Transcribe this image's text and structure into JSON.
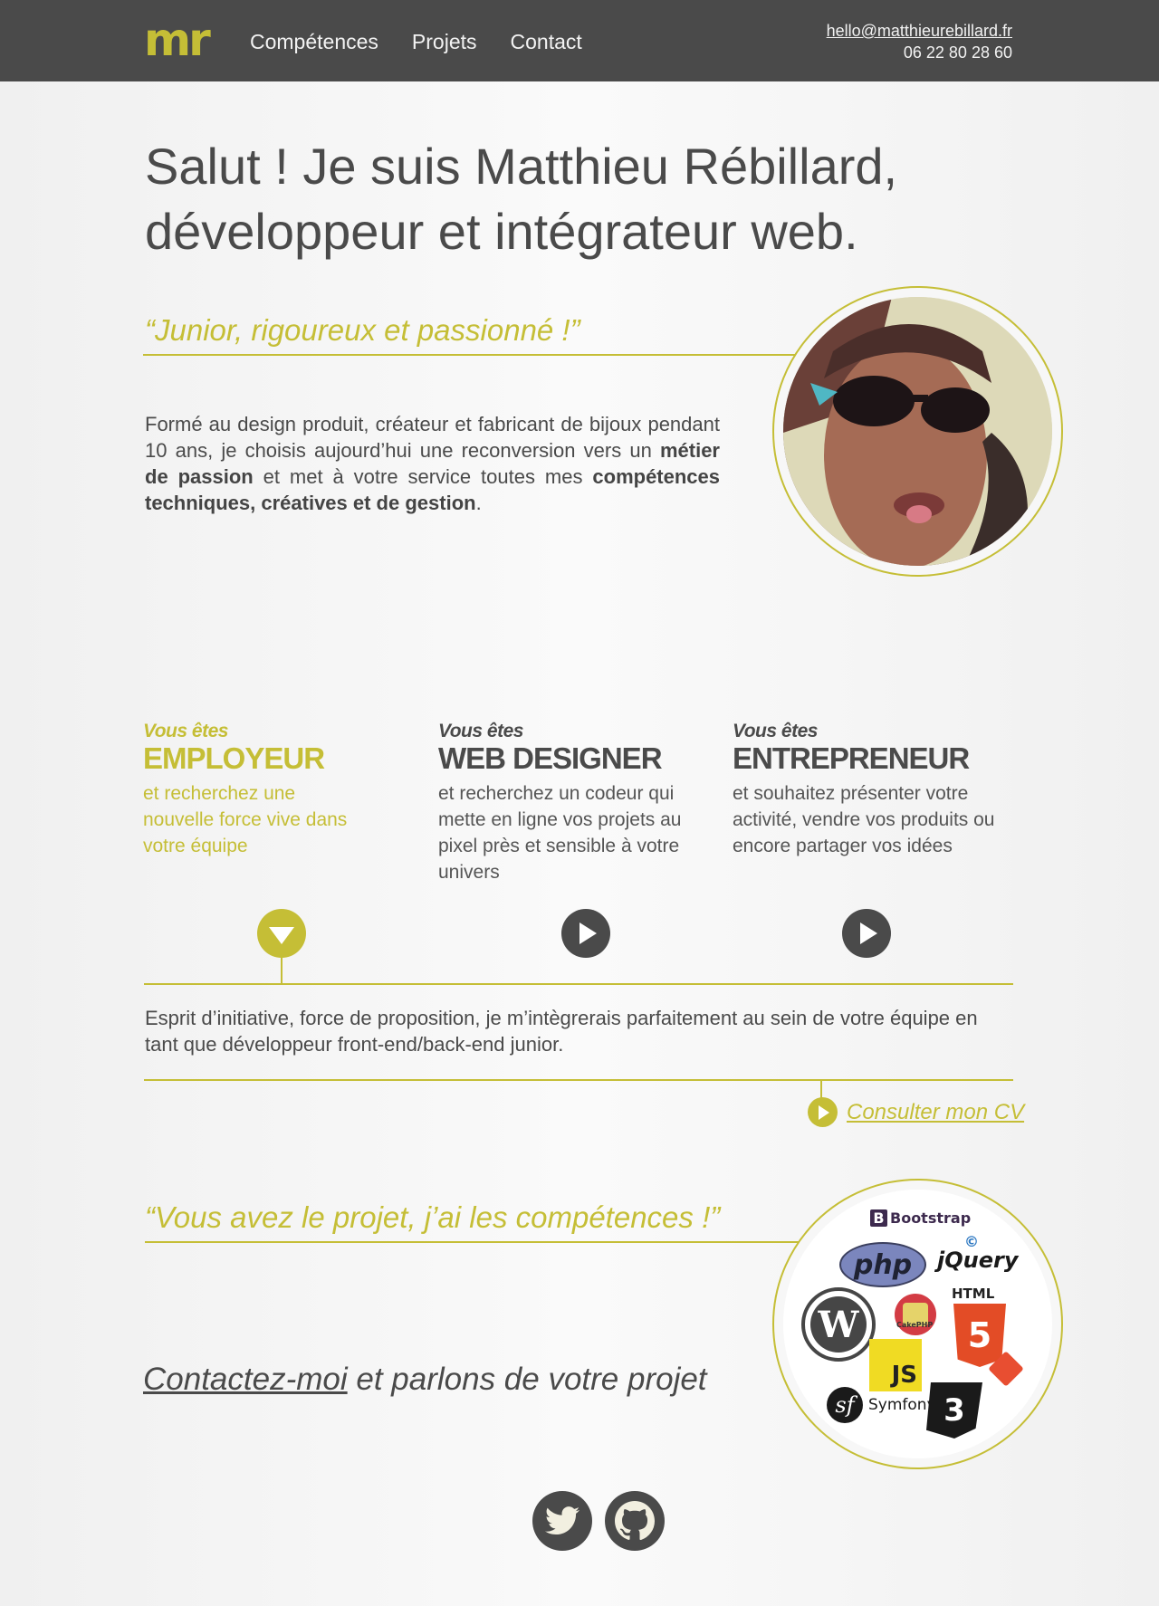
{
  "header": {
    "logo": "mr",
    "nav": [
      "Compétences",
      "Projets",
      "Contact"
    ],
    "email": "hello@matthieurebillard.fr",
    "phone": "06 22 80 28 60"
  },
  "intro": {
    "headline_line1": "Salut ! Je suis Matthieu Rébillard,",
    "headline_line2": "développeur et intégrateur web.",
    "quote": "“Junior, rigoureux et passionné !”",
    "text_part1": "Formé au design produit, créateur et fabricant de bijoux pendant 10 ans, je choisis aujourd’hui une reconversion vers un ",
    "text_bold1": "métier de passion",
    "text_part2": " et met à votre service toutes mes ",
    "text_bold2": "compétences techniques, créatives et de gestion",
    "text_part3": "."
  },
  "audiences": [
    {
      "pre": "Vous êtes",
      "role": "EMPLOYEUR",
      "desc": "et recherchez une nouvelle force vive dans votre équipe"
    },
    {
      "pre": "Vous êtes",
      "role": "WEB DESIGNER",
      "desc": "et recherchez un codeur qui mette en ligne vos projets au pixel près et sensible à votre univers"
    },
    {
      "pre": "Vous êtes",
      "role": "ENTREPRENEUR",
      "desc": "et souhaitez présenter votre activité, vendre vos produits ou encore partager vos idées"
    }
  ],
  "employer_text": "Esprit d’initiative, force de proposition, je m’intègrerais parfaitement au sein de votre équipe en tant que développeur front-end/back-end junior.",
  "cv_link": "Consulter mon CV",
  "skills": {
    "quote": "“Vous avez le projet, j’ai les compétences !”",
    "logos": {
      "bootstrap": "Bootstrap",
      "php": "php",
      "jquery": "jQuery",
      "html": "HTML",
      "html_num": "5",
      "cake": "CakePHP",
      "js": "JS",
      "symfony": "Symfony",
      "css_num": "3"
    }
  },
  "contact": {
    "link": "Contactez-moi",
    "rest": " et parlons de votre projet"
  },
  "colors": {
    "accent": "#c5be36",
    "dark": "#4a4a4a"
  },
  "icons": [
    "play-icon",
    "arrow-down-icon",
    "twitter-icon",
    "github-icon"
  ]
}
